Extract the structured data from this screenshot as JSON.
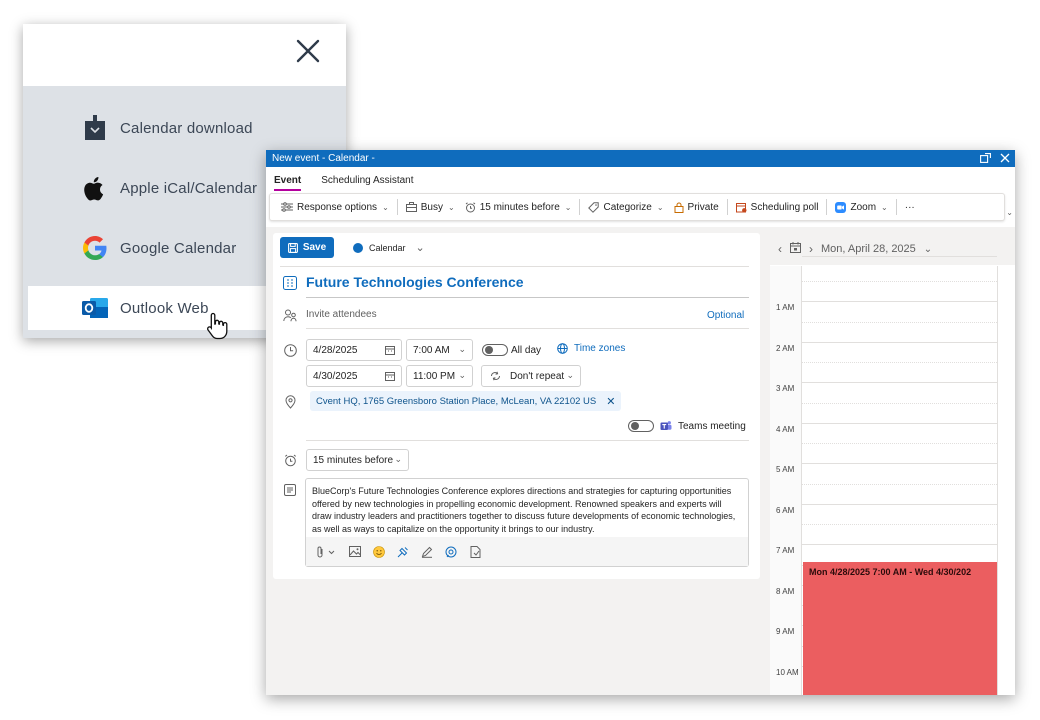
{
  "popup": {
    "close_label": "×",
    "options": [
      {
        "label": "Calendar download",
        "icon": "calendar-download-icon"
      },
      {
        "label": "Apple iCal/Calendar",
        "icon": "apple-icon"
      },
      {
        "label": "Google Calendar",
        "icon": "google-icon"
      },
      {
        "label": "Outlook Web",
        "icon": "outlook-icon",
        "selected": true
      }
    ]
  },
  "window": {
    "title": "New event - Calendar -",
    "tabs": [
      {
        "label": "Event",
        "active": true
      },
      {
        "label": "Scheduling Assistant",
        "active": false
      }
    ],
    "ribbon": {
      "response_options": "Response options",
      "busy": "Busy",
      "reminder": "15 minutes before",
      "categorize": "Categorize",
      "private": "Private",
      "scheduling_poll": "Scheduling poll",
      "zoom": "Zoom",
      "more": "···"
    }
  },
  "form": {
    "save_label": "Save",
    "calendar_label": "Calendar",
    "title": "Future Technologies Conference",
    "attendees_placeholder": "Invite attendees",
    "optional_label": "Optional",
    "start_date": "4/28/2025",
    "start_time": "7:00 AM",
    "all_day_label": "All day",
    "time_zones_label": "Time zones",
    "end_date": "4/30/2025",
    "end_time": "11:00 PM",
    "repeat_label": "Don't repeat",
    "location": "Cvent HQ, 1765 Greensboro Station Place, McLean, VA 22102 US",
    "teams_label": "Teams meeting",
    "reminder": "15 minutes before",
    "description": "BlueCorp's Future Technologies Conference explores directions and strategies for capturing opportunities offered by new technologies in propelling economic development. Renowned speakers and experts will draw industry leaders and practitioners together to discuss future developments of economic technologies, as well as ways to capitalize on the opportunity it brings to our industry."
  },
  "calendar": {
    "date_label": "Mon, April 28, 2025",
    "hours": [
      "1 AM",
      "2 AM",
      "3 AM",
      "4 AM",
      "5 AM",
      "6 AM",
      "7 AM",
      "8 AM",
      "9 AM",
      "10 AM"
    ],
    "event_label": "Mon 4/28/2025 7:00 AM - Wed 4/30/202"
  },
  "colors": {
    "accent": "#0f6cbd",
    "tab_underline": "#b4009e",
    "event": "#eb5e60"
  }
}
